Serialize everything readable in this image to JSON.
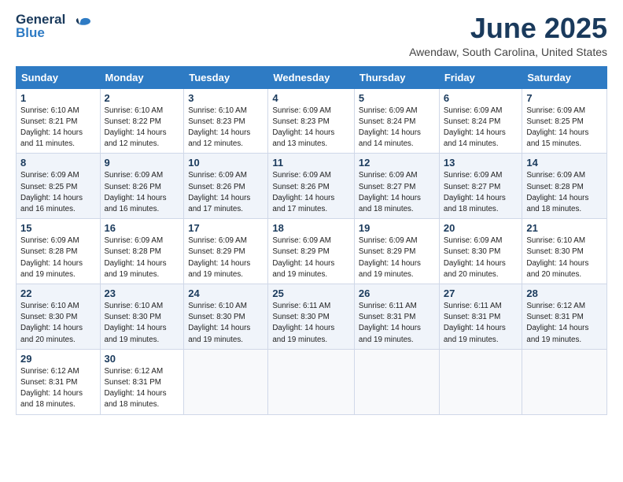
{
  "logo": {
    "line1": "General",
    "line2": "Blue"
  },
  "title": "June 2025",
  "subtitle": "Awendaw, South Carolina, United States",
  "days_of_week": [
    "Sunday",
    "Monday",
    "Tuesday",
    "Wednesday",
    "Thursday",
    "Friday",
    "Saturday"
  ],
  "weeks": [
    [
      {
        "day": 1,
        "rise": "6:10 AM",
        "set": "8:21 PM",
        "hours": "14",
        "mins": "11"
      },
      {
        "day": 2,
        "rise": "6:10 AM",
        "set": "8:22 PM",
        "hours": "14",
        "mins": "12"
      },
      {
        "day": 3,
        "rise": "6:10 AM",
        "set": "8:23 PM",
        "hours": "14",
        "mins": "12"
      },
      {
        "day": 4,
        "rise": "6:09 AM",
        "set": "8:23 PM",
        "hours": "14",
        "mins": "13"
      },
      {
        "day": 5,
        "rise": "6:09 AM",
        "set": "8:24 PM",
        "hours": "14",
        "mins": "14"
      },
      {
        "day": 6,
        "rise": "6:09 AM",
        "set": "8:24 PM",
        "hours": "14",
        "mins": "14"
      },
      {
        "day": 7,
        "rise": "6:09 AM",
        "set": "8:25 PM",
        "hours": "14",
        "mins": "15"
      }
    ],
    [
      {
        "day": 8,
        "rise": "6:09 AM",
        "set": "8:25 PM",
        "hours": "14",
        "mins": "16"
      },
      {
        "day": 9,
        "rise": "6:09 AM",
        "set": "8:26 PM",
        "hours": "14",
        "mins": "16"
      },
      {
        "day": 10,
        "rise": "6:09 AM",
        "set": "8:26 PM",
        "hours": "14",
        "mins": "17"
      },
      {
        "day": 11,
        "rise": "6:09 AM",
        "set": "8:26 PM",
        "hours": "14",
        "mins": "17"
      },
      {
        "day": 12,
        "rise": "6:09 AM",
        "set": "8:27 PM",
        "hours": "14",
        "mins": "18"
      },
      {
        "day": 13,
        "rise": "6:09 AM",
        "set": "8:27 PM",
        "hours": "14",
        "mins": "18"
      },
      {
        "day": 14,
        "rise": "6:09 AM",
        "set": "8:28 PM",
        "hours": "14",
        "mins": "18"
      }
    ],
    [
      {
        "day": 15,
        "rise": "6:09 AM",
        "set": "8:28 PM",
        "hours": "14",
        "mins": "19"
      },
      {
        "day": 16,
        "rise": "6:09 AM",
        "set": "8:28 PM",
        "hours": "14",
        "mins": "19"
      },
      {
        "day": 17,
        "rise": "6:09 AM",
        "set": "8:29 PM",
        "hours": "14",
        "mins": "19"
      },
      {
        "day": 18,
        "rise": "6:09 AM",
        "set": "8:29 PM",
        "hours": "14",
        "mins": "19"
      },
      {
        "day": 19,
        "rise": "6:09 AM",
        "set": "8:29 PM",
        "hours": "14",
        "mins": "19"
      },
      {
        "day": 20,
        "rise": "6:09 AM",
        "set": "8:30 PM",
        "hours": "14",
        "mins": "20"
      },
      {
        "day": 21,
        "rise": "6:10 AM",
        "set": "8:30 PM",
        "hours": "14",
        "mins": "20"
      }
    ],
    [
      {
        "day": 22,
        "rise": "6:10 AM",
        "set": "8:30 PM",
        "hours": "14",
        "mins": "20"
      },
      {
        "day": 23,
        "rise": "6:10 AM",
        "set": "8:30 PM",
        "hours": "14",
        "mins": "19"
      },
      {
        "day": 24,
        "rise": "6:10 AM",
        "set": "8:30 PM",
        "hours": "14",
        "mins": "19"
      },
      {
        "day": 25,
        "rise": "6:11 AM",
        "set": "8:30 PM",
        "hours": "14",
        "mins": "19"
      },
      {
        "day": 26,
        "rise": "6:11 AM",
        "set": "8:31 PM",
        "hours": "14",
        "mins": "19"
      },
      {
        "day": 27,
        "rise": "6:11 AM",
        "set": "8:31 PM",
        "hours": "14",
        "mins": "19"
      },
      {
        "day": 28,
        "rise": "6:12 AM",
        "set": "8:31 PM",
        "hours": "14",
        "mins": "19"
      }
    ],
    [
      {
        "day": 29,
        "rise": "6:12 AM",
        "set": "8:31 PM",
        "hours": "14",
        "mins": "18"
      },
      {
        "day": 30,
        "rise": "6:12 AM",
        "set": "8:31 PM",
        "hours": "14",
        "mins": "18"
      },
      null,
      null,
      null,
      null,
      null
    ]
  ]
}
